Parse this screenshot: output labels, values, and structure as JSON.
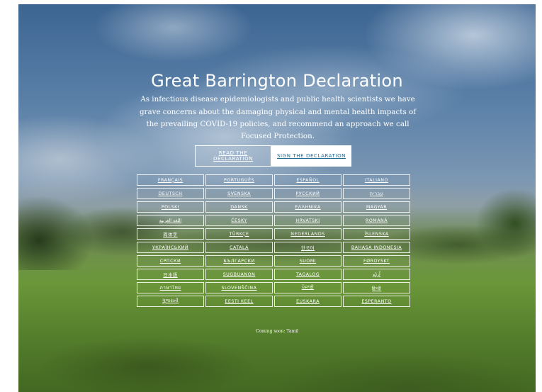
{
  "hero": {
    "title": "Great Barrington Declaration",
    "lead": "As infectious disease epidemiologists and public health scientists we have grave concerns about the damaging physical and mental health impacts of the prevailing COVID-19 policies, and recommend an approach we call Focused Protection."
  },
  "buttons": {
    "read": "READ THE DECLARATION",
    "sign": "SIGN THE DECLARATION"
  },
  "languages": [
    "FRANÇAIS",
    "PORTUGUÊS",
    "ESPAÑOL",
    "ITALIANO",
    "DEUTSCH",
    "SVENSKA",
    "РУССКИЙ",
    "עברית",
    "POLSKI",
    "DANSK",
    "ΕΛΛΗΝΙΚΑ",
    "MAGYAR",
    "اللغة العربية",
    "ČESKY",
    "HRVATSKI",
    "ROMÂNĂ",
    "简体字",
    "TÜRKÇE",
    "NEDERLANDS",
    "ÍSLENSKA",
    "УКРАЇНСЬКИЙ",
    "CATALÀ",
    "한국어",
    "BAHASA INDONESIA",
    "СРПСКИ",
    "БЪЛГАРСКИ",
    "SUOMI",
    "FØROYSKT",
    "日本語",
    "SUGBUANON",
    "TAGALOG",
    "اُردُو",
    "ภาษาไทย",
    "SLOVENŠČINA",
    "ਪੰਜਾਬੀ",
    "हिन्दी",
    "ગુજરાતી",
    "EESTI KEEL",
    "EUSKARA",
    "ESPERANTO"
  ],
  "coming_soon": "Coming soon: Tamil"
}
